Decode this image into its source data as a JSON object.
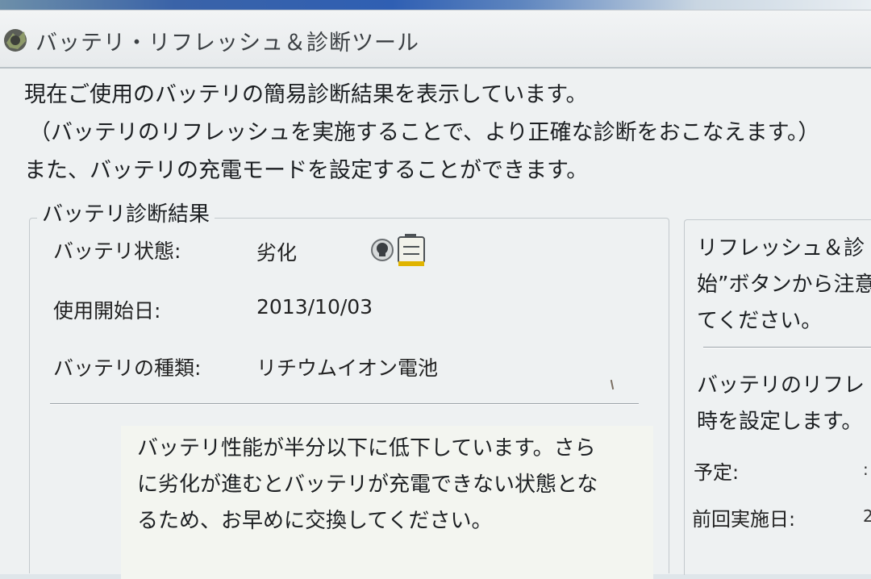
{
  "window": {
    "title": "バッテリ・リフレッシュ＆診断ツール"
  },
  "intro": {
    "line1": "現在ご使用のバッテリの簡易診断結果を表示しています。",
    "line2": "（バッテリのリフレッシュを実施することで、より正確な診断をおこなえます。）",
    "line3": "また、バッテリの充電モードを設定することができます。"
  },
  "diagnosis": {
    "legend": "バッテリ診断結果",
    "status_label": "バッテリ状態:",
    "status_value": "劣化",
    "status_icon": "battery-degraded-icon",
    "start_date_label": "使用開始日:",
    "start_date_value": "2013/10/03",
    "type_label": "バッテリの種類:",
    "type_value": "リチウムイオン電池",
    "message_line1": "バッテリ性能が半分以下に低下しています。さら",
    "message_line2": "に劣化が進むとバッテリが充電できない状態とな",
    "message_line3": "るため、お早めに交換してください。"
  },
  "refresh": {
    "text_line1": "リフレッシュ＆診",
    "text_line2": "始”ボタンから注意",
    "text_line3": "てください。",
    "schedule_line1": "バッテリのリフレ",
    "schedule_line2": "時を設定します。",
    "planned_label": "予定:",
    "last_run_label": "前回実施日:",
    "planned_value_fragment": ":",
    "last_run_value_fragment": "2"
  }
}
